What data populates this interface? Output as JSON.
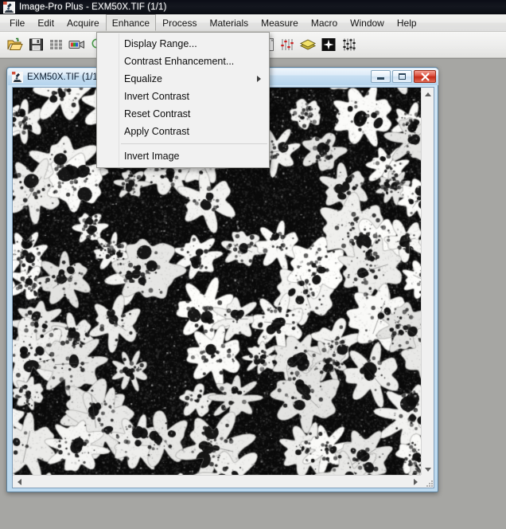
{
  "app": {
    "title": "Image-Pro Plus - EXM50X.TIF (1/1)",
    "icon": "microscope-icon"
  },
  "menubar": {
    "items": [
      {
        "label": "File",
        "name": "menu-file",
        "active": false
      },
      {
        "label": "Edit",
        "name": "menu-edit",
        "active": false
      },
      {
        "label": "Acquire",
        "name": "menu-acquire",
        "active": false
      },
      {
        "label": "Enhance",
        "name": "menu-enhance",
        "active": true
      },
      {
        "label": "Process",
        "name": "menu-process",
        "active": false
      },
      {
        "label": "Materials",
        "name": "menu-materials",
        "active": false
      },
      {
        "label": "Measure",
        "name": "menu-measure",
        "active": false
      },
      {
        "label": "Macro",
        "name": "menu-macro",
        "active": false
      },
      {
        "label": "Window",
        "name": "menu-window",
        "active": false
      },
      {
        "label": "Help",
        "name": "menu-help",
        "active": false
      }
    ]
  },
  "toolbar": {
    "buttons": [
      {
        "icon": "open-folder-icon",
        "name": "toolbar-open"
      },
      {
        "icon": "save-floppy-icon",
        "name": "toolbar-save"
      },
      {
        "icon": "grid-thumbnails-icon",
        "name": "toolbar-thumbnails"
      },
      {
        "icon": "video-camera-icon",
        "name": "toolbar-capture"
      },
      {
        "icon": "magnifier-icon",
        "name": "toolbar-preview-zoom"
      },
      {
        "icon": "crescent-select-icon",
        "name": "toolbar-aoi"
      },
      {
        "icon": "open-box-icon",
        "name": "toolbar-extract"
      },
      {
        "icon": "pencil-edit-icon",
        "name": "toolbar-draw"
      },
      {
        "icon": "magnifier-icon",
        "name": "toolbar-zoom"
      },
      {
        "icon": "hand-pan-icon",
        "name": "toolbar-pan"
      },
      {
        "icon": "contrast-sliders-icon",
        "name": "toolbar-contrast"
      },
      {
        "icon": "histogram-icon",
        "name": "toolbar-histogram"
      },
      {
        "icon": "levels-sliders-icon",
        "name": "toolbar-levels"
      },
      {
        "icon": "layers-icon",
        "name": "toolbar-layers"
      },
      {
        "icon": "sharpen-star-icon",
        "name": "toolbar-sharpen"
      },
      {
        "icon": "filter-bars-icon",
        "name": "toolbar-filters"
      }
    ]
  },
  "dropdown": {
    "owner": "Enhance",
    "items": [
      {
        "label": "Display Range...",
        "name": "menuitem-display-range",
        "submenu": false,
        "separator_after": false
      },
      {
        "label": "Contrast Enhancement...",
        "name": "menuitem-contrast-enhancement",
        "submenu": false,
        "separator_after": false
      },
      {
        "label": "Equalize",
        "name": "menuitem-equalize",
        "submenu": true,
        "separator_after": false
      },
      {
        "label": "Invert Contrast",
        "name": "menuitem-invert-contrast",
        "submenu": false,
        "separator_after": false
      },
      {
        "label": "Reset Contrast",
        "name": "menuitem-reset-contrast",
        "submenu": false,
        "separator_after": false
      },
      {
        "label": "Apply Contrast",
        "name": "menuitem-apply-contrast",
        "submenu": false,
        "separator_after": true
      },
      {
        "label": "Invert Image",
        "name": "menuitem-invert-image",
        "submenu": false,
        "separator_after": false
      }
    ]
  },
  "child_window": {
    "title": "EXM50X.TIF (1/1)",
    "icon": "microscope-icon",
    "buttons": {
      "minimize": "Minimize",
      "maximize": "Maximize",
      "close": "Close"
    },
    "image": {
      "description": "Grayscale micrograph: bright irregular particles with dark inclusions on dark background",
      "background_color": "#0a0a0a",
      "particle_color": "#f2f2ee"
    },
    "scrollbars": {
      "vertical": "vertical-scrollbar",
      "horizontal": "horizontal-scrollbar"
    }
  },
  "colors": {
    "app_titlebar": "#0e1018",
    "menubar": "#ebebe9",
    "toolbar": "#eeeeec",
    "mdi_background": "#a6a6a3",
    "child_frame": "#bcd9ef",
    "close_button": "#c52c18",
    "menu_background": "#f1f1f1"
  }
}
